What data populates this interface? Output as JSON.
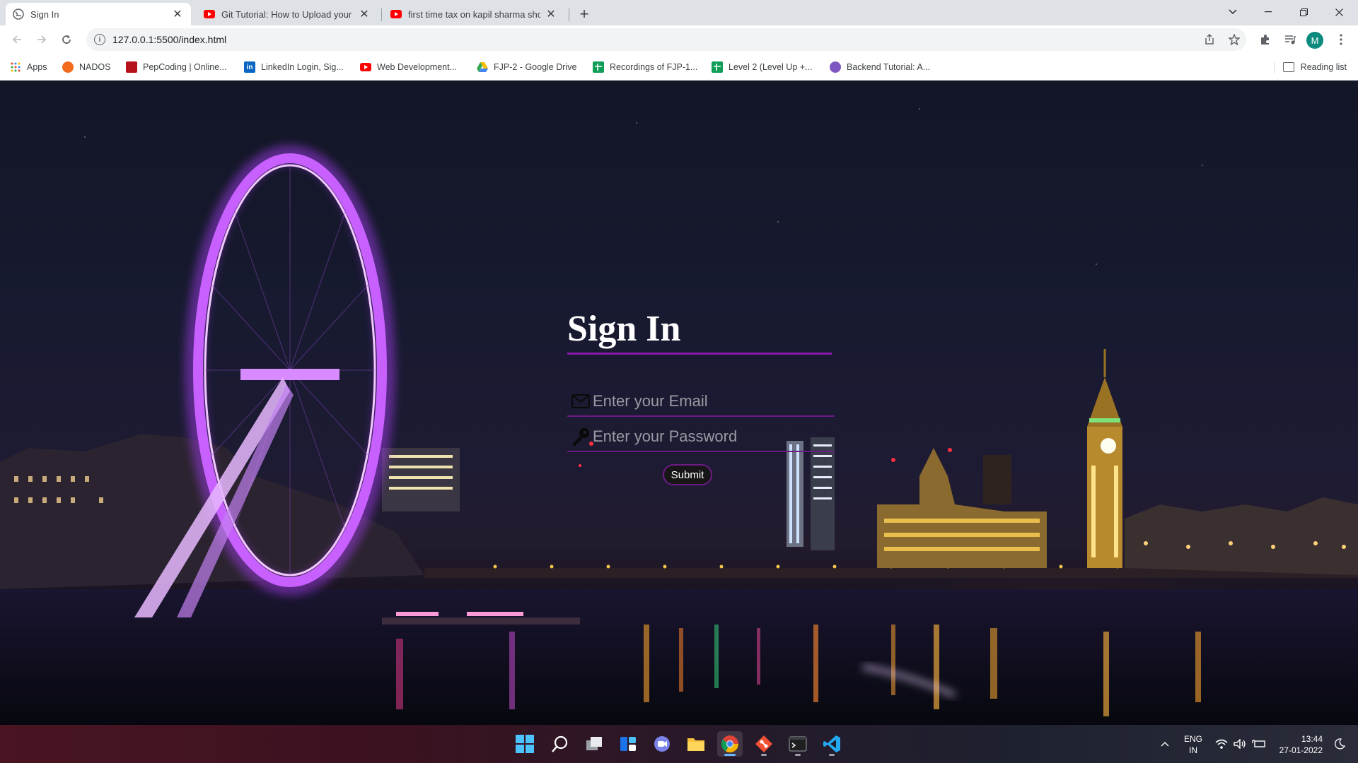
{
  "browser": {
    "tabs": [
      {
        "title": "Sign In",
        "active": true,
        "favicon": "globe-icon"
      },
      {
        "title": "Git Tutorial: How to Upload your",
        "active": false,
        "favicon": "youtube-icon"
      },
      {
        "title": "first time tax on kapil sharma sho",
        "active": false,
        "favicon": "youtube-icon"
      }
    ],
    "address_url": "127.0.0.1:5500/index.html",
    "profile_initial": "M",
    "bookmarks": [
      {
        "label": "Apps",
        "icon": "apps-grid-icon"
      },
      {
        "label": "NADOS",
        "icon": "nados-icon"
      },
      {
        "label": "PepCoding | Online...",
        "icon": "pepcoding-icon"
      },
      {
        "label": "LinkedIn Login, Sig...",
        "icon": "linkedin-icon"
      },
      {
        "label": "Web Development...",
        "icon": "youtube-icon"
      },
      {
        "label": "FJP-2 - Google Drive",
        "icon": "google-drive-icon"
      },
      {
        "label": "Recordings of FJP-1...",
        "icon": "google-sheets-icon"
      },
      {
        "label": "Level 2 (Level Up +...",
        "icon": "google-sheets-icon"
      },
      {
        "label": "Backend Tutorial: A...",
        "icon": "avatar-icon"
      }
    ],
    "reading_list": "Reading list"
  },
  "page": {
    "title": "Sign In",
    "email_placeholder": "Enter your Email",
    "password_placeholder": "Enter your Password",
    "submit_label": "Submit",
    "accent_color": "#8a1aa8"
  },
  "taskbar": {
    "language_line1": "ENG",
    "language_line2": "IN",
    "time": "13:44",
    "date": "27-01-2022"
  }
}
